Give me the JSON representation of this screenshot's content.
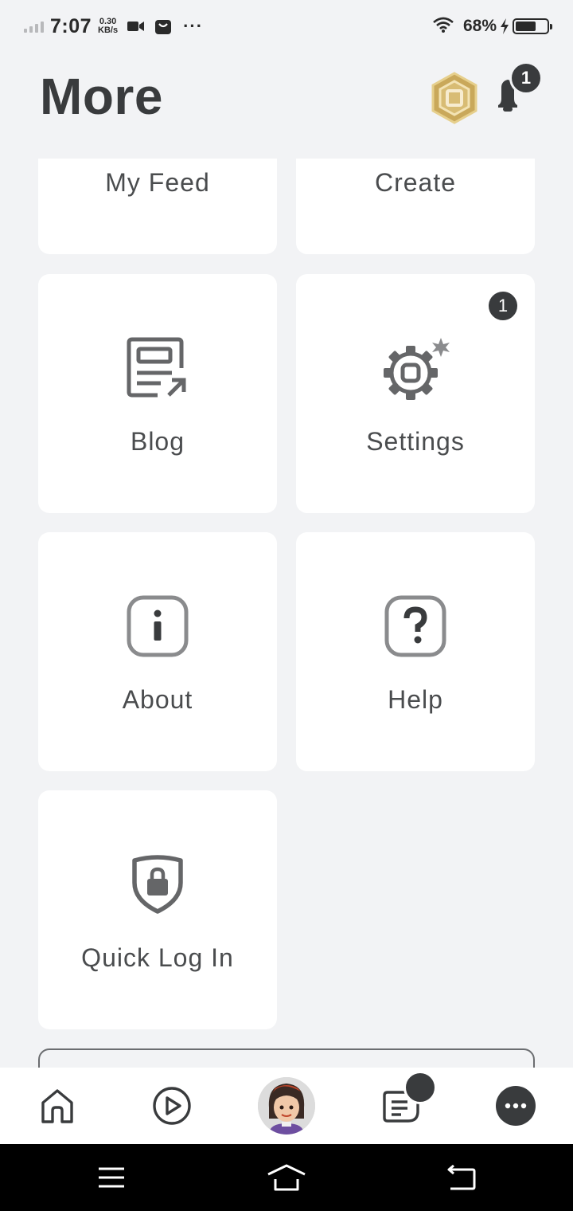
{
  "status_bar": {
    "time": "7:07",
    "net_speed_value": "0.30",
    "net_speed_unit": "KB/s",
    "overflow": "···",
    "battery_percent": "68%",
    "battery_level": 0.68,
    "icons": [
      "signal-icon",
      "video-icon",
      "bag-icon",
      "wifi-icon",
      "charging-icon",
      "battery-icon"
    ]
  },
  "header": {
    "title": "More",
    "robux_icon": "robux-icon",
    "notification_count": "1"
  },
  "tiles": [
    {
      "label": "My Feed",
      "icon": ""
    },
    {
      "label": "Create",
      "icon": ""
    },
    {
      "label": "Blog",
      "icon": "blog-icon"
    },
    {
      "label": "Settings",
      "icon": "settings-icon",
      "badge": "1"
    },
    {
      "label": "About",
      "icon": "info-icon"
    },
    {
      "label": "Help",
      "icon": "help-icon"
    },
    {
      "label": "Quick Log In",
      "icon": "shield-lock-icon"
    }
  ],
  "bottom_nav": {
    "items": [
      "home-icon",
      "play-icon",
      "avatar",
      "chat-icon",
      "more-icon"
    ]
  },
  "android_nav": {
    "items": [
      "menu-icon",
      "home-icon",
      "back-icon"
    ]
  },
  "colors": {
    "background": "#f2f3f5",
    "tile": "#ffffff",
    "text": "#393b3d",
    "icon": "#656668",
    "badge": "#393b3d"
  }
}
